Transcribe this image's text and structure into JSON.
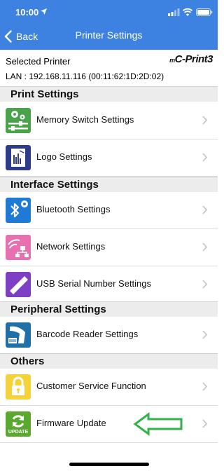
{
  "status": {
    "time": "10:00"
  },
  "nav": {
    "back_label": "Back",
    "title": "Printer Settings"
  },
  "printer": {
    "selected_label": "Selected Printer",
    "lan": "LAN : 192.168.11.116 (00:11:62:1D:2D:02)",
    "brand_prefix": "m",
    "brand": "C-Print3"
  },
  "sections": {
    "print": "Print Settings",
    "interface": "Interface Settings",
    "peripheral": "Peripheral Settings",
    "others": "Others"
  },
  "items": {
    "memory_switch": "Memory Switch Settings",
    "logo": "Logo Settings",
    "bluetooth": "Bluetooth Settings",
    "network": "Network Settings",
    "usb_serial": "USB Serial Number Settings",
    "barcode": "Barcode Reader Settings",
    "customer_service": "Customer Service Function",
    "firmware": "Firmware Update",
    "update_badge": "UPDATE"
  },
  "colors": {
    "nav_bar": "#3d82e0",
    "section_bg": "#ececec",
    "arrow": "#33b24a"
  }
}
